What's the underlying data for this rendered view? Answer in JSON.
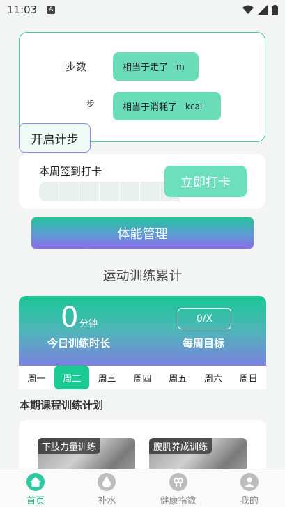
{
  "status": {
    "time": "11:03"
  },
  "step_card": {
    "steps_label": "步数",
    "step_unit": "步",
    "distance_text": "相当于走了",
    "distance_unit": "m",
    "calorie_text": "相当于消耗了",
    "calorie_unit": "kcal",
    "start_button": "开启计步"
  },
  "checkin": {
    "title": "本周签到打卡",
    "button": "立即打卡",
    "days_count": 7
  },
  "fitness_button": "体能管理",
  "training": {
    "section_title": "运动训练累计",
    "minutes": "0",
    "minutes_unit": "分钟",
    "today_label": "今日训练时长",
    "goal_value": "0/X",
    "goal_label": "每周目标"
  },
  "week": {
    "days": [
      "周一",
      "周二",
      "周三",
      "周四",
      "周五",
      "周六",
      "周日"
    ],
    "active_index": 1
  },
  "plan": {
    "title": "本期课程训练计划",
    "courses": [
      "下肢力量训练",
      "腹肌养成训练"
    ]
  },
  "tabs": [
    {
      "label": "首页",
      "icon": "home-icon",
      "active": true
    },
    {
      "label": "补水",
      "icon": "water-drop-icon",
      "active": false
    },
    {
      "label": "健康指数",
      "icon": "health-index-icon",
      "active": false
    },
    {
      "label": "我的",
      "icon": "user-icon",
      "active": false
    }
  ],
  "colors": {
    "accent": "#1ccb92",
    "purple": "#8a6de8"
  }
}
